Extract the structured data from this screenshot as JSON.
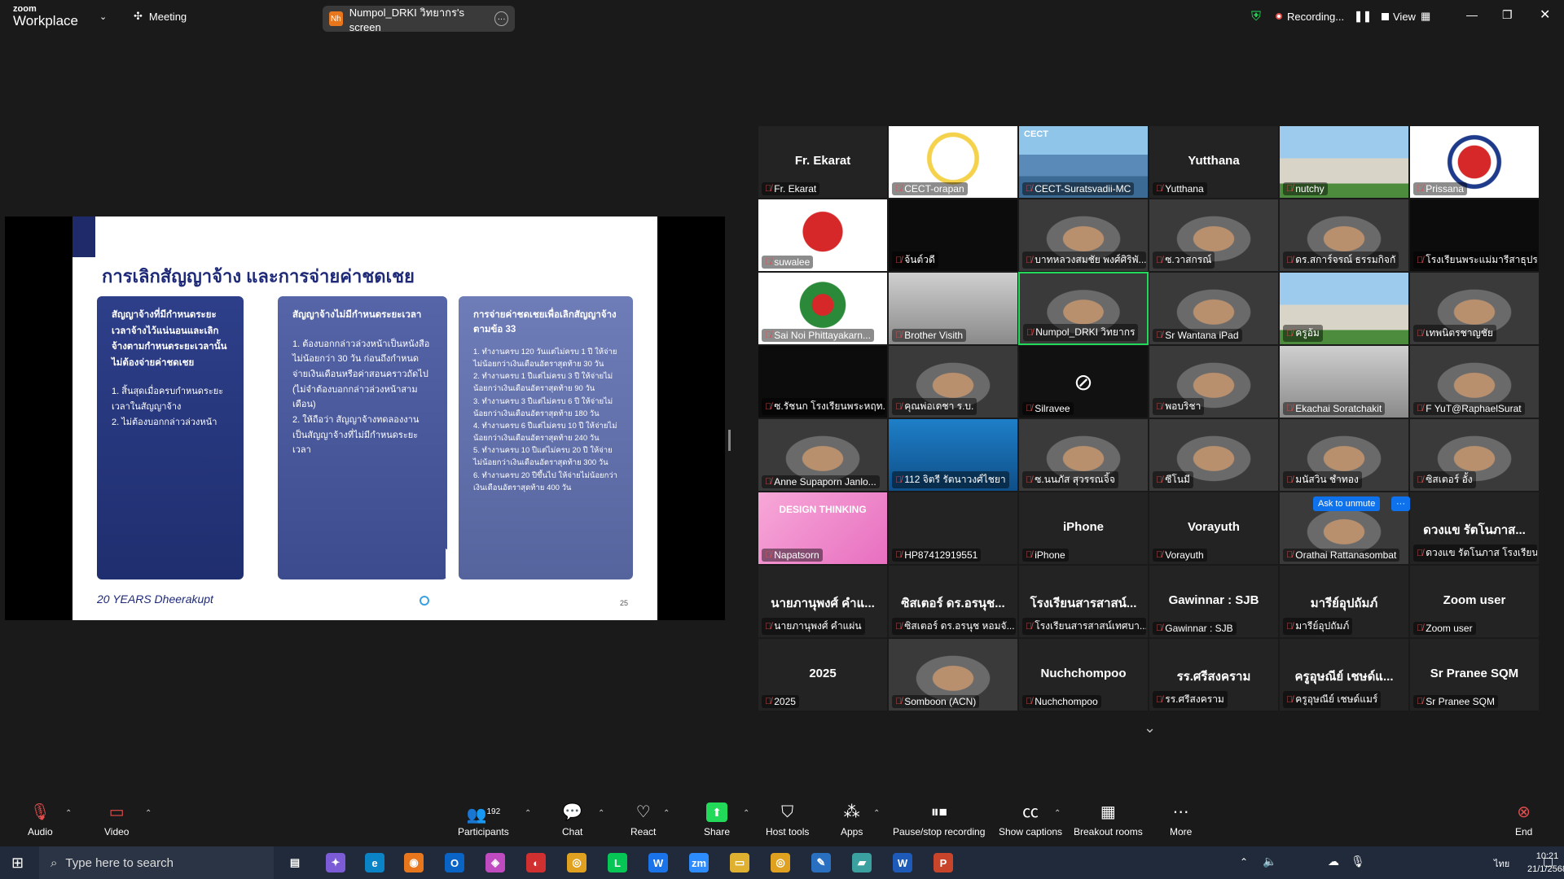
{
  "app": {
    "logo_line1": "zoom",
    "logo_line2": "Workplace",
    "meeting_label": "Meeting",
    "share_avatar": "Nh",
    "share_label": "Numpol_DRKI วิทยากร's screen",
    "recording_label": "Recording...",
    "view_label": "View"
  },
  "slide": {
    "title": "การเลิกสัญญาจ้าง และการจ่ายค่าชดเชย",
    "col1_head": "สัญญาจ้างที่มีกำหนดระยะเวลาจ้างไว้แน่นอนและเลิกจ้างตามกำหนดระยะเวลานั้น ไม่ต้องจ่ายค่าชดเชย",
    "col1_items": [
      "1. สิ้นสุดเมื่อครบกำหนดระยะเวลาในสัญญาจ้าง",
      "2. ไม่ต้องบอกกล่าวล่วงหน้า"
    ],
    "col2_head": "สัญญาจ้างไม่มีกำหนดระยะเวลา",
    "col2_items": [
      "1. ต้องบอกกล่าวล่วงหน้าเป็นหนังสือไม่น้อยกว่า 30 วัน ก่อนถึงกำหนดจ่ายเงินเดือนหรือค่าสอนคราวถัดไป (ไม่จำต้องบอกกล่าวล่วงหน้าสามเดือน)",
      "2. ให้ถือว่า สัญญาจ้างทดลองงานเป็นสัญญาจ้างที่ไม่มีกำหนดระยะเวลา"
    ],
    "col3_head": "การจ่ายค่าชดเชยเพื่อเลิกสัญญาจ้างตามข้อ 33",
    "col3_items": [
      "1. ทำงานครบ 120 วันแต่ไม่ครบ 1 ปี ให้จ่ายไม่น้อยกว่าเงินเดือนอัตราสุดท้าย 30 วัน",
      "2. ทำงานครบ 1 ปีแต่ไม่ครบ 3 ปี ให้จ่ายไม่น้อยกว่าเงินเดือนอัตราสุดท้าย 90 วัน",
      "3. ทำงานครบ 3 ปีแต่ไม่ครบ 6 ปี ให้จ่ายไม่น้อยกว่าเงินเดือนอัตราสุดท้าย 180 วัน",
      "4. ทำงานครบ 6 ปีแต่ไม่ครบ 10 ปี ให้จ่ายไม่น้อยกว่าเงินเดือนอัตราสุดท้าย 240 วัน",
      "5. ทำงานครบ 10 ปีแต่ไม่ครบ 20 ปี ให้จ่ายไม่น้อยกว่าเงินเดือนอัตราสุดท้าย 300 วัน",
      "6. ทำงานครบ 20 ปีขึ้นไป ให้จ่ายไม่น้อยกว่าเงินเดือนอัตราสุดท้าย 400 วัน"
    ],
    "footer": "20 YEARS Dheerakupt",
    "page": "25"
  },
  "tiles": [
    {
      "big": "Fr. Ekarat",
      "label": "Fr. Ekarat"
    },
    {
      "big": "",
      "label": "CECT-orapan",
      "img": "logo"
    },
    {
      "big": "CECT",
      "label": "CECT-Suratsvadii-MC",
      "img": "mountain"
    },
    {
      "big": "Yutthana",
      "label": "Yutthana"
    },
    {
      "big": "",
      "label": "nutchy",
      "img": "building"
    },
    {
      "big": "",
      "label": "Prissana",
      "img": "logo2"
    },
    {
      "big": "",
      "label": "suwalee",
      "img": "logo3"
    },
    {
      "big": "",
      "label": "จ้นต์วดี",
      "img": "dark"
    },
    {
      "big": "",
      "label": "บาทหลวงสมชัย พงศ์ศิริพั...",
      "img": "face"
    },
    {
      "big": "",
      "label": "ซ.วาสกรณ์",
      "img": "face"
    },
    {
      "big": "",
      "label": "ดร.สการ์จรณ์ ธรรมกิจกั",
      "img": "face"
    },
    {
      "big": "",
      "label": "โรงเรียนพระแม่มารีสาธุปร...",
      "img": "dark"
    },
    {
      "big": "",
      "label": "Sai Noi Phittayakarn...",
      "img": "logo4"
    },
    {
      "big": "",
      "label": "Brother Visith",
      "img": "room"
    },
    {
      "big": "",
      "label": "Numpol_DRKI วิทยากร",
      "img": "face",
      "active": true
    },
    {
      "big": "",
      "label": "Sr Wantana iPad",
      "img": "face"
    },
    {
      "big": "",
      "label": "ครูอ้ม",
      "img": "building"
    },
    {
      "big": "",
      "label": "เทพนิตรชาญชัย",
      "img": "face"
    },
    {
      "big": "",
      "label": "ซ.รัชนก โรงเรียนพระหฤท...",
      "img": "dark"
    },
    {
      "big": "",
      "label": "คุณพ่อเดชา ร.บ.",
      "img": "face"
    },
    {
      "big": "",
      "label": "Silravee",
      "img": "camoff"
    },
    {
      "big": "",
      "label": "พอบริชา",
      "img": "face"
    },
    {
      "big": "",
      "label": "Ekachai Soratchakit",
      "img": "room"
    },
    {
      "big": "",
      "label": "F YuT@RaphaelSurat",
      "img": "face"
    },
    {
      "big": "",
      "label": "Anne Supaporn Janlo...",
      "img": "face"
    },
    {
      "big": "",
      "label": "112 จิตรี รัตนาวงศ์ไชยา",
      "img": "blue"
    },
    {
      "big": "",
      "label": "ซ.นนภัส สุวรรณจิ้จ",
      "img": "face"
    },
    {
      "big": "",
      "label": "ซีโนมี",
      "img": "face"
    },
    {
      "big": "",
      "label": "มนัสวิน ชำทอง",
      "img": "face"
    },
    {
      "big": "",
      "label": "ซิสเตอร์ อั้ง",
      "img": "face"
    },
    {
      "big": "DESIGN THINKING",
      "label": "Napatsorn",
      "img": "pink"
    },
    {
      "big": "",
      "label": "HP87412919551"
    },
    {
      "big": "iPhone",
      "label": "iPhone"
    },
    {
      "big": "Vorayuth",
      "label": "Vorayuth"
    },
    {
      "big": "",
      "label": "Orathai Rattanasombat",
      "img": "face"
    },
    {
      "big": "ดวงแข รัตโนภาส...",
      "label": "ดวงแข รัตโนภาส โรงเรียน..."
    },
    {
      "big": "นายภานุพงศ์ คำแ...",
      "label": "นายภานุพงศ์ คำแผ่น"
    },
    {
      "big": "ซิสเตอร์ ดร.อรนุช...",
      "label": "ซิสเตอร์ ดร.อรนุช หอมจั..."
    },
    {
      "big": "โรงเรียนสารสาสน์...",
      "label": "โรงเรียนสารสาสน์เทศบา..."
    },
    {
      "big": "Gawinnar : SJB",
      "label": "Gawinnar : SJB"
    },
    {
      "big": "มารีย์อุปถัมภ์",
      "label": "มารีย์อุปถัมภ์"
    },
    {
      "big": "Zoom user",
      "label": "Zoom user"
    },
    {
      "big": "2025",
      "label": "2025"
    },
    {
      "big": "",
      "label": "Somboon (ACN)",
      "img": "face"
    },
    {
      "big": "Nuchchompoo",
      "label": "Nuchchompoo"
    },
    {
      "big": "รร.ศรีสงคราม",
      "label": "รร.ศรีสงคราม"
    },
    {
      "big": "ครูอุษณีย์ เชษด์แ...",
      "label": "ครูอุษณีย์ เชษด์แมร์"
    },
    {
      "big": "Sr Pranee SQM",
      "label": "Sr Pranee SQM"
    }
  ],
  "unmute": {
    "label": "Ask to unmute",
    "more": "···"
  },
  "toolbar": {
    "audio": "Audio",
    "video": "Video",
    "participants": "Participants",
    "participants_count": "192",
    "chat": "Chat",
    "react": "React",
    "share": "Share",
    "host_tools": "Host tools",
    "apps": "Apps",
    "pause_rec": "Pause/stop recording",
    "captions": "Show captions",
    "breakout": "Breakout rooms",
    "more": "More",
    "end": "End"
  },
  "taskbar": {
    "search_placeholder": "Type here to search",
    "time": "10:21",
    "date": "21/1/2568",
    "lang": "ไทย"
  },
  "colors": {
    "accent": "#0e72ed",
    "active_border": "#23d959",
    "muted": "#e24d4d"
  }
}
